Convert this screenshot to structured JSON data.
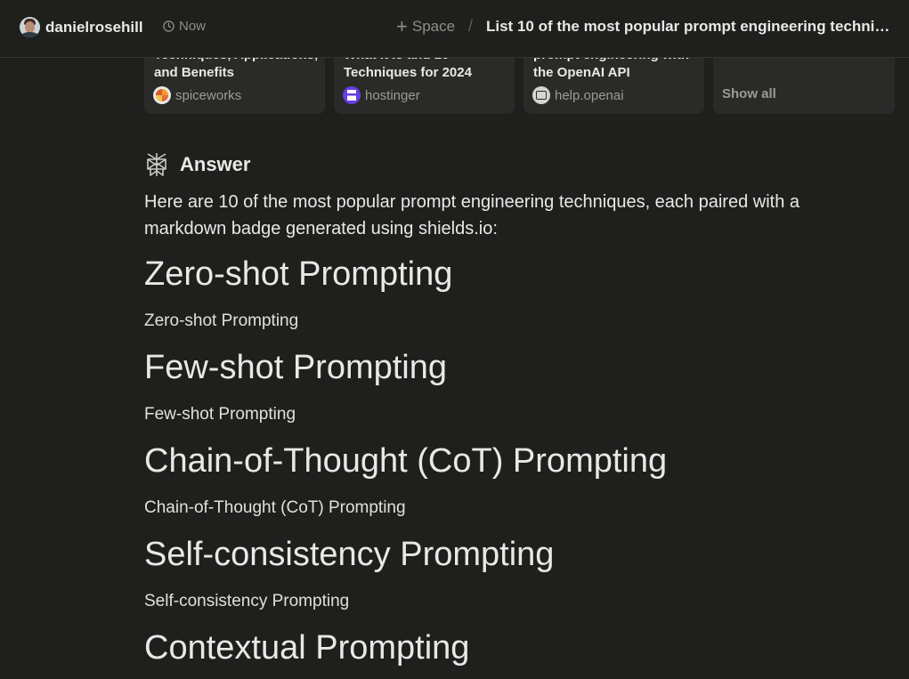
{
  "header": {
    "username": "danielrosehill",
    "time": "Now",
    "space_label": "Space",
    "thread_title": "List 10 of the most popular prompt engineering techniques"
  },
  "sources": [
    {
      "title": "Techniques, Applications, and Benefits",
      "site": "spiceworks"
    },
    {
      "title": "What It Is and 15 Techniques for 2024",
      "site": "hostinger"
    },
    {
      "title": "prompt engineering with the OpenAI API",
      "site": "help.openai"
    }
  ],
  "show_all": "Show all",
  "answer": {
    "label": "Answer",
    "intro": "Here are 10 of the most popular prompt engineering techniques, each paired with a markdown badge generated using shields.io:",
    "techniques": [
      {
        "heading": "Zero-shot Prompting",
        "badge_alt": "Zero-shot Prompting"
      },
      {
        "heading": "Few-shot Prompting",
        "badge_alt": "Few-shot Prompting"
      },
      {
        "heading": "Chain-of-Thought (CoT) Prompting",
        "badge_alt": "Chain-of-Thought (CoT) Prompting"
      },
      {
        "heading": "Self-consistency Prompting",
        "badge_alt": "Self-consistency Prompting"
      },
      {
        "heading": "Contextual Prompting",
        "badge_alt": ""
      }
    ]
  },
  "colors": {
    "background": "#1f201e",
    "card": "#2a2b28",
    "text": "#e8e8e6",
    "muted": "#8d8e89"
  }
}
